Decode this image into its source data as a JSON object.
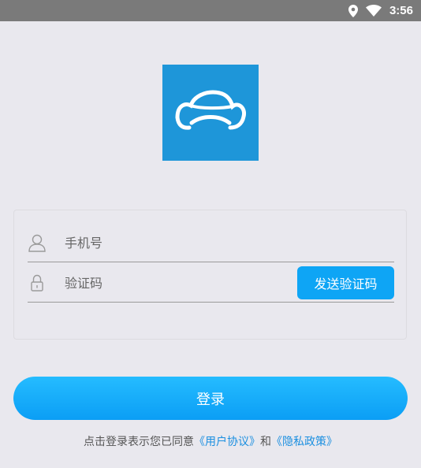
{
  "status_bar": {
    "time": "3:56",
    "icons": [
      "location-icon",
      "wifi-icon"
    ]
  },
  "logo": {
    "icon": "cloud-car-icon",
    "background": "#1e96d9"
  },
  "form": {
    "phone_placeholder": "手机号",
    "code_placeholder": "验证码",
    "send_code_label": "发送验证码",
    "phone_icon": "user-icon",
    "code_icon": "lock-icon"
  },
  "login_label": "登录",
  "agreement": {
    "prefix": "点击登录表示您已同意",
    "user_agreement": "《用户协议》",
    "conjunction": "和",
    "privacy_policy": "《隐私政策》"
  },
  "colors": {
    "accent": "#0ea5f5",
    "link": "#1b8fe0",
    "status_bar": "#7a7a7a",
    "background": "#e9e8ee"
  }
}
